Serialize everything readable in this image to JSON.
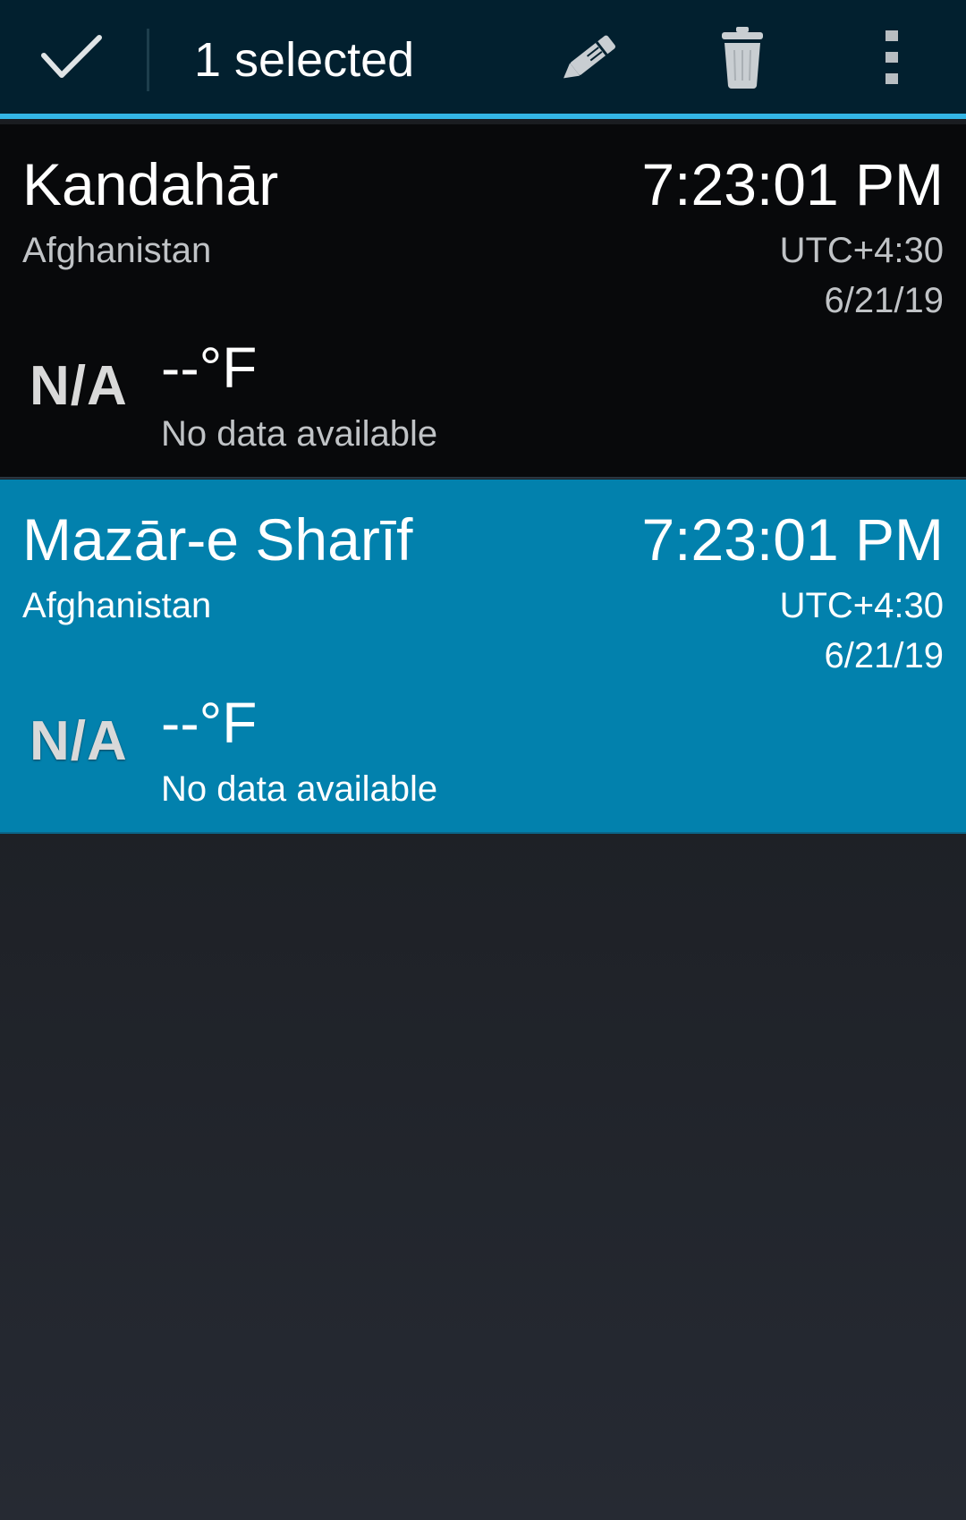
{
  "action_bar": {
    "selected_text": "1 selected",
    "icons": {
      "done": "checkmark-icon",
      "edit": "pencil-icon",
      "delete": "trash-icon",
      "overflow": "more-vertical-icon"
    }
  },
  "clocks": [
    {
      "city": "Kandahār",
      "country": "Afghanistan",
      "time": "7:23:01 PM",
      "utc_offset": "UTC+4:30",
      "date": "6/21/19",
      "weather_icon_text": "N/A",
      "temperature": "--°F",
      "condition": "No data available",
      "selected": false
    },
    {
      "city": "Mazār-e Sharīf",
      "country": "Afghanistan",
      "time": "7:23:01 PM",
      "utc_offset": "UTC+4:30",
      "date": "6/21/19",
      "weather_icon_text": "N/A",
      "temperature": "--°F",
      "condition": "No data available",
      "selected": true
    }
  ],
  "colors": {
    "action_bar_bg": "#02202f",
    "accent": "#33b5e5",
    "selected_item_bg": "#0281ad",
    "item_bg": "#08090b"
  }
}
